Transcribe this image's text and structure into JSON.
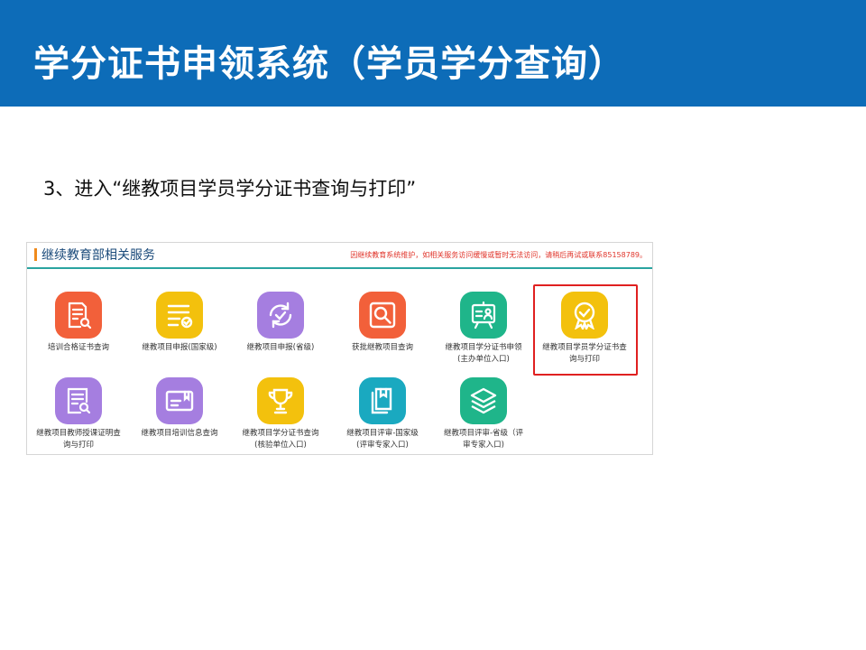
{
  "header": {
    "title": "学分证书申领系统（学员学分查询）",
    "bg_color": "#0d6cb8"
  },
  "step_text": "3、进入“继教项目学员学分证书查询与打印”",
  "panel": {
    "title": "继续教育部相关服务",
    "notice": "因继续教育系统维护，如相关服务访问缓慢或暂时无法访问，请稍后再试或联系85158789。",
    "tiles": [
      {
        "label_line1": "培训合格证书查询",
        "label_line2": "",
        "icon": "certificate-search-icon",
        "color": "#f2603a"
      },
      {
        "label_line1": "继教项目申报(国家级)",
        "label_line2": "",
        "icon": "list-check-icon",
        "color": "#f3c10d"
      },
      {
        "label_line1": "继教项目申报(省级)",
        "label_line2": "",
        "icon": "refresh-check-icon",
        "color": "#a57ee0"
      },
      {
        "label_line1": "获批继教项目查询",
        "label_line2": "",
        "icon": "magnifier-icon",
        "color": "#f2603a"
      },
      {
        "label_line1": "继教项目学分证书申领",
        "label_line2": "(主办单位入口)",
        "icon": "presentation-board-icon",
        "color": "#1fb58a"
      },
      {
        "label_line1": "继教项目学员学分证书查",
        "label_line2": "询与打印",
        "icon": "award-badge-icon",
        "color": "#f3c10d"
      },
      {
        "label_line1": "继教项目教师授课证明查",
        "label_line2": "询与打印",
        "icon": "document-search-icon",
        "color": "#a57ee0"
      },
      {
        "label_line1": "继教项目培训信息查询",
        "label_line2": "",
        "icon": "id-card-icon",
        "color": "#a57ee0"
      },
      {
        "label_line1": "继教项目学分证书查询",
        "label_line2": "(核验单位入口)",
        "icon": "trophy-icon",
        "color": "#f3c10d"
      },
      {
        "label_line1": "继教项目评审-国家级",
        "label_line2": "(评审专家入口)",
        "icon": "book-stack-icon",
        "color": "#1aa9c0"
      },
      {
        "label_line1": "继教项目评审-省级（评",
        "label_line2": "审专家入口)",
        "icon": "layers-icon",
        "color": "#1fb58a"
      }
    ]
  }
}
